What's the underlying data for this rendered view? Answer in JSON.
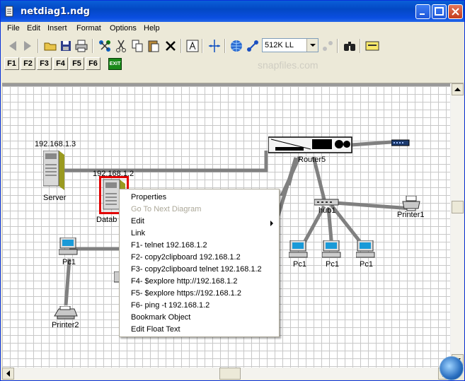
{
  "window": {
    "title": "netdiag1.ndg"
  },
  "menubar": {
    "items": [
      "File",
      "Edit",
      "Insert",
      "Format",
      "Options",
      "Help"
    ]
  },
  "toolbar": {
    "line_style_value": "512K LL",
    "fkeys": [
      "F1",
      "F2",
      "F3",
      "F4",
      "F5",
      "F6"
    ],
    "exit_label": "EXIT"
  },
  "watermark": "snapfiles.com",
  "diagram": {
    "server_ip": "192.168.1.3",
    "server_label": "Server",
    "database_ip": "192.168.1.2",
    "database_label": "Datab",
    "router_label": "Router5",
    "hub_label": "hub1",
    "printer1_label": "Printer1",
    "printer2_label": "Printer2",
    "pc_left_label": "Pc1",
    "pc_labels": [
      "Pc1",
      "Pc1",
      "Pc1"
    ]
  },
  "context_menu": {
    "items": [
      {
        "label": "Properties",
        "disabled": false
      },
      {
        "label": "Go To Next Diagram",
        "disabled": true
      },
      {
        "label": "Edit",
        "disabled": false,
        "submenu": true
      },
      {
        "label": "Link",
        "disabled": false
      },
      {
        "label": "F1- telnet 192.168.1.2",
        "disabled": false
      },
      {
        "label": "F2- copy2clipboard 192.168.1.2",
        "disabled": false
      },
      {
        "label": "F3- copy2clipboard telnet 192.168.1.2",
        "disabled": false
      },
      {
        "label": "F4- $explore http://192.168.1.2",
        "disabled": false
      },
      {
        "label": "F5- $explore https://192.168.1.2",
        "disabled": false
      },
      {
        "label": "F6- ping -t 192.168.1.2",
        "disabled": false
      },
      {
        "label": "Bookmark Object",
        "disabled": false
      },
      {
        "label": "Edit Float Text",
        "disabled": false
      }
    ]
  },
  "colors": {
    "link": "#808080",
    "selection": "#e00000",
    "title_bar": "#0a4ee0"
  }
}
